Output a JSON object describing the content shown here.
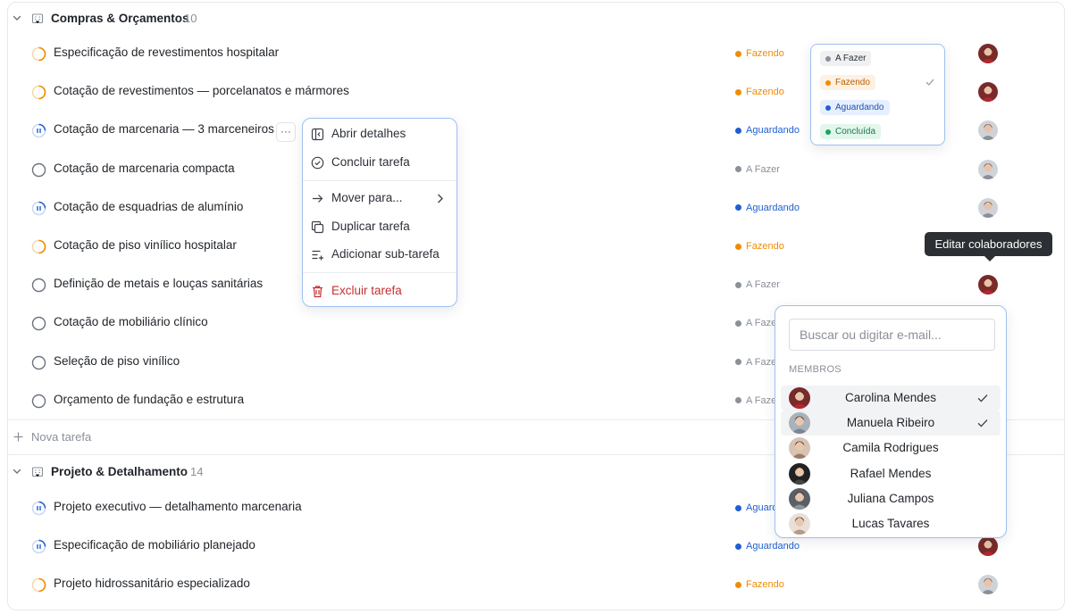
{
  "groups": [
    {
      "name": "Compras & Orçamentos",
      "count": "10"
    },
    {
      "name": "Projeto & Detalhamento",
      "count": "14"
    }
  ],
  "tasks_group1": [
    {
      "title": "Especificação de revestimentos hospitalar",
      "status": "Fazendo",
      "state": "doing",
      "avatar": "red"
    },
    {
      "title": "Cotação de revestimentos — porcelanatos e mármores",
      "status": "Fazendo",
      "state": "doing",
      "avatar": "red"
    },
    {
      "title": "Cotação de marcenaria — 3 marceneiros",
      "status": "Aguardando",
      "state": "waiting",
      "avatar": "gray"
    },
    {
      "title": "Cotação de marcenaria compacta",
      "status": "A Fazer",
      "state": "todo",
      "avatar": "gray"
    },
    {
      "title": "Cotação de esquadrias de alumínio",
      "status": "Aguardando",
      "state": "waiting",
      "avatar": "gray"
    },
    {
      "title": "Cotação de piso vinílico hospitalar",
      "status": "Fazendo",
      "state": "doing",
      "avatar": "none"
    },
    {
      "title": "Definição de metais e louças sanitárias",
      "status": "A Fazer",
      "state": "todo",
      "avatar": "red"
    },
    {
      "title": "Cotação de mobiliário clínico",
      "status": "A Faze",
      "state": "todo",
      "avatar": "none"
    },
    {
      "title": "Seleção de piso vinílico",
      "status": "A Faze",
      "state": "todo",
      "avatar": "none"
    },
    {
      "title": "Orçamento de fundação e estrutura",
      "status": "A Faze",
      "state": "todo",
      "avatar": "none"
    }
  ],
  "tasks_group2": [
    {
      "title": "Projeto executivo — detalhamento marcenaria",
      "status": "Aguard",
      "state": "waiting",
      "avatar": "none"
    },
    {
      "title": "Especificação de mobiliário planejado",
      "status": "Aguardando",
      "state": "waiting",
      "avatar": "red"
    },
    {
      "title": "Projeto hidrossanitário especializado",
      "status": "Fazendo",
      "state": "doing",
      "avatar": "gray"
    }
  ],
  "new_task_label": "Nova tarefa",
  "more_button_label": "···",
  "context_menu": {
    "open_details": "Abrir detalhes",
    "complete_task": "Concluir tarefa",
    "move_to": "Mover para...",
    "duplicate": "Duplicar tarefa",
    "add_subtask": "Adicionar sub-tarefa",
    "delete": "Excluir tarefa"
  },
  "status_dropdown": {
    "options": [
      "A Fazer",
      "Fazendo",
      "Aguardando",
      "Concluída"
    ],
    "selected": "Fazendo"
  },
  "tooltip": "Editar colaboradores",
  "collaborators": {
    "placeholder": "Buscar ou digitar e-mail...",
    "section": "MEMBROS",
    "members": [
      {
        "name": "Carolina Mendes",
        "selected": true
      },
      {
        "name": "Manuela Ribeiro",
        "selected": true
      },
      {
        "name": "Camila Rodrigues",
        "selected": false
      },
      {
        "name": "Rafael Mendes",
        "selected": false
      },
      {
        "name": "Juliana Campos",
        "selected": false
      },
      {
        "name": "Lucas Tavares",
        "selected": false
      }
    ]
  },
  "colors": {
    "doing": "#f08c00",
    "waiting": "#1f5fd1",
    "todo": "#8a8f98",
    "done": "#1aa35f",
    "danger": "#c53030",
    "accent_border": "#9fc0ee"
  }
}
